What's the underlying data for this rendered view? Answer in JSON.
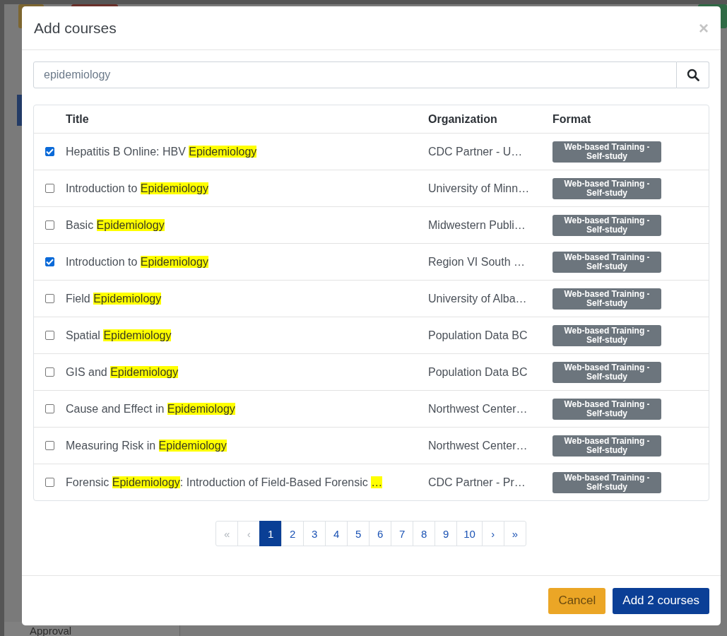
{
  "background": {
    "sidebar_text": "Approval"
  },
  "modal": {
    "title": "Add courses",
    "close": "×"
  },
  "search": {
    "value": "epidemiology"
  },
  "table": {
    "columns": [
      "Title",
      "Organization",
      "Format"
    ],
    "rows": [
      {
        "checked": true,
        "title": [
          {
            "text": "Hepatitis B Online: HBV ",
            "highlight": false
          },
          {
            "text": "Epidemiology",
            "highlight": true
          }
        ],
        "organization": "CDC Partner - U…",
        "format": "Web-based Training - Self-study"
      },
      {
        "checked": false,
        "title": [
          {
            "text": "Introduction to ",
            "highlight": false
          },
          {
            "text": "Epidemiology",
            "highlight": true
          }
        ],
        "organization": "University of Minn…",
        "format": "Web-based Training - Self-study"
      },
      {
        "checked": false,
        "title": [
          {
            "text": "Basic ",
            "highlight": false
          },
          {
            "text": "Epidemiology",
            "highlight": true
          }
        ],
        "organization": "Midwestern Publi…",
        "format": "Web-based Training - Self-study"
      },
      {
        "checked": true,
        "title": [
          {
            "text": "Introduction to ",
            "highlight": false
          },
          {
            "text": "Epidemiology",
            "highlight": true
          }
        ],
        "organization": "Region VI South …",
        "format": "Web-based Training - Self-study"
      },
      {
        "checked": false,
        "title": [
          {
            "text": "Field ",
            "highlight": false
          },
          {
            "text": "Epidemiology",
            "highlight": true
          }
        ],
        "organization": "University of Alba…",
        "format": "Web-based Training - Self-study"
      },
      {
        "checked": false,
        "title": [
          {
            "text": "Spatial ",
            "highlight": false
          },
          {
            "text": "Epidemiology",
            "highlight": true
          }
        ],
        "organization": "Population Data BC",
        "format": "Web-based Training - Self-study"
      },
      {
        "checked": false,
        "title": [
          {
            "text": "GIS and ",
            "highlight": false
          },
          {
            "text": "Epidemiology",
            "highlight": true
          }
        ],
        "organization": "Population Data BC",
        "format": "Web-based Training - Self-study"
      },
      {
        "checked": false,
        "title": [
          {
            "text": "Cause and Effect in ",
            "highlight": false
          },
          {
            "text": "Epidemiology",
            "highlight": true
          }
        ],
        "organization": "Northwest Center…",
        "format": "Web-based Training - Self-study"
      },
      {
        "checked": false,
        "title": [
          {
            "text": "Measuring Risk in ",
            "highlight": false
          },
          {
            "text": "Epidemiology",
            "highlight": true
          }
        ],
        "organization": "Northwest Center…",
        "format": "Web-based Training - Self-study"
      },
      {
        "checked": false,
        "title": [
          {
            "text": "Forensic ",
            "highlight": false
          },
          {
            "text": "Epidemiology",
            "highlight": true
          },
          {
            "text": ": Introduction of Field-Based Forensic ",
            "highlight": false
          },
          {
            "text": "…",
            "highlight": true
          }
        ],
        "organization": "CDC Partner - Pr…",
        "format": "Web-based Training - Self-study"
      }
    ]
  },
  "pagination": [
    {
      "label": "«",
      "selected": false,
      "disabled": true
    },
    {
      "label": "‹",
      "selected": false,
      "disabled": true
    },
    {
      "label": "1",
      "selected": true,
      "disabled": false
    },
    {
      "label": "2",
      "selected": false,
      "disabled": false
    },
    {
      "label": "3",
      "selected": false,
      "disabled": false
    },
    {
      "label": "4",
      "selected": false,
      "disabled": false
    },
    {
      "label": "5",
      "selected": false,
      "disabled": false
    },
    {
      "label": "6",
      "selected": false,
      "disabled": false
    },
    {
      "label": "7",
      "selected": false,
      "disabled": false
    },
    {
      "label": "8",
      "selected": false,
      "disabled": false
    },
    {
      "label": "9",
      "selected": false,
      "disabled": false
    },
    {
      "label": "10",
      "selected": false,
      "disabled": false
    },
    {
      "label": "›",
      "selected": false,
      "disabled": false
    },
    {
      "label": "»",
      "selected": false,
      "disabled": false
    }
  ],
  "buttons": [
    {
      "label": "Cancel",
      "kind": "secondary"
    },
    {
      "label": "Add 2 courses",
      "kind": "primary"
    }
  ]
}
